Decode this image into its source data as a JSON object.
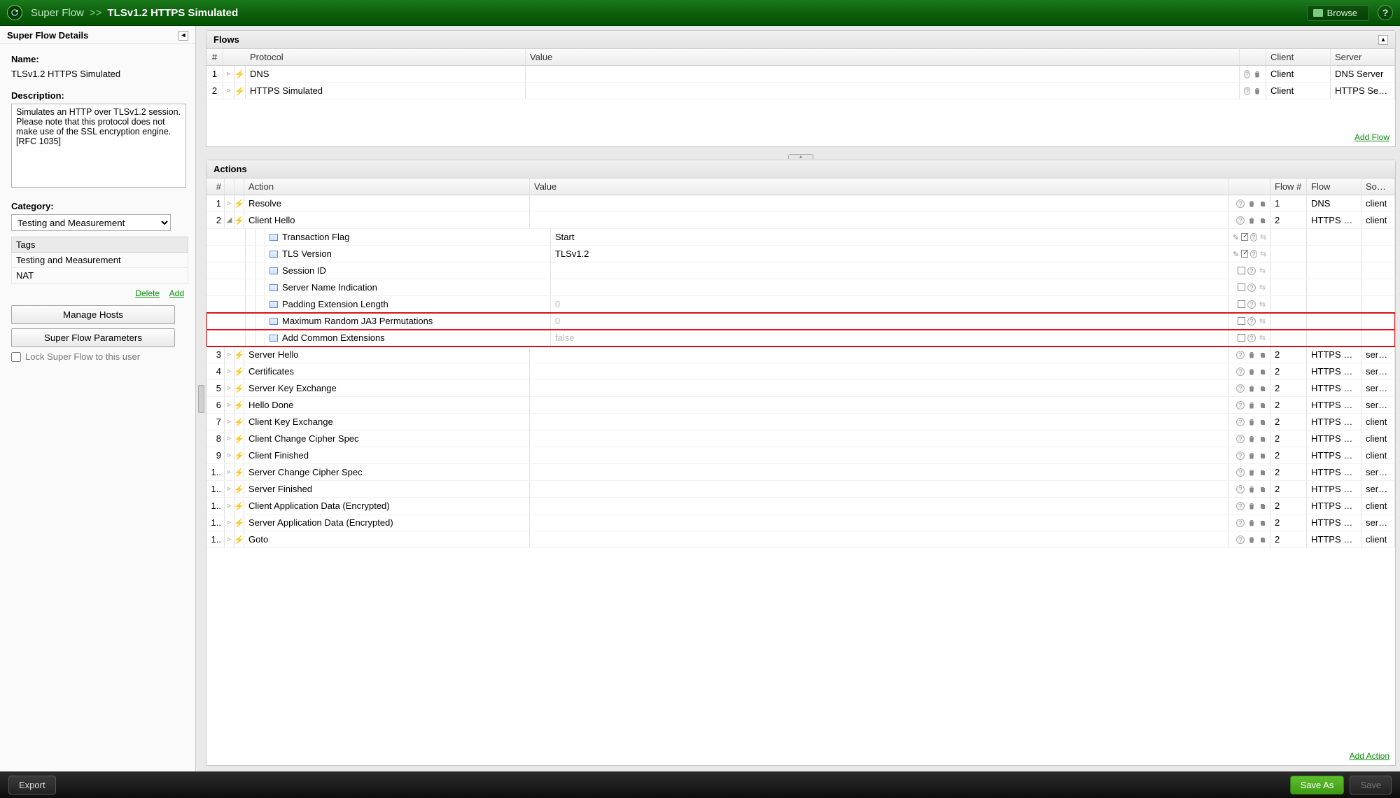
{
  "topbar": {
    "breadcrumb_root": "Super Flow",
    "breadcrumb_sep": ">>",
    "breadcrumb_current": "TLSv1.2 HTTPS Simulated",
    "browse": "Browse",
    "help": "?"
  },
  "side": {
    "panel_title": "Super Flow Details",
    "name_label": "Name:",
    "name_value": "TLSv1.2 HTTPS Simulated",
    "desc_label": "Description:",
    "desc_value": "Simulates an HTTP over TLSv1.2 session. Please note that this protocol does not make use of the SSL encryption engine.[RFC 1035]",
    "cat_label": "Category:",
    "cat_value": "Testing and Measurement",
    "tags_header": "Tags",
    "tags": [
      "Testing and Measurement",
      "NAT"
    ],
    "delete": "Delete",
    "add": "Add",
    "manage_hosts": "Manage Hosts",
    "sf_params": "Super Flow Parameters",
    "lock_label": "Lock Super Flow to this user"
  },
  "flows_panel": {
    "title": "Flows",
    "headers": {
      "num": "#",
      "protocol": "Protocol",
      "value": "Value",
      "client": "Client",
      "server": "Server"
    },
    "rows": [
      {
        "num": "1",
        "protocol": "DNS",
        "value": "",
        "client": "Client",
        "server": "DNS Server"
      },
      {
        "num": "2",
        "protocol": "HTTPS Simulated",
        "value": "",
        "client": "Client",
        "server": "HTTPS Server"
      }
    ],
    "add_flow": "Add Flow"
  },
  "actions_panel": {
    "title": "Actions",
    "headers": {
      "num": "#",
      "action": "Action",
      "value": "Value",
      "flownum": "Flow #",
      "flow": "Flow",
      "source": "Source"
    },
    "rows": [
      {
        "num": "1",
        "action": "Resolve",
        "value": "",
        "flownum": "1",
        "flow": "DNS",
        "source": "client",
        "exp": "▹"
      },
      {
        "num": "2",
        "action": "Client Hello",
        "value": "",
        "flownum": "2",
        "flow": "HTTPS Sim...",
        "source": "client",
        "exp": "◢",
        "children": [
          {
            "action": "Transaction Flag",
            "value": "Start",
            "ctrl": "edit"
          },
          {
            "action": "TLS Version",
            "value": "TLSv1.2",
            "ctrl": "edit"
          },
          {
            "action": "Session ID",
            "value": "",
            "ctrl": "cb"
          },
          {
            "action": "Server Name Indication",
            "value": "",
            "ctrl": "cb"
          },
          {
            "action": "Padding Extension Length",
            "value": "0",
            "ghost": true,
            "ctrl": "cb"
          },
          {
            "action": "Maximum Random JA3 Permutations",
            "value": "0",
            "ghost": true,
            "ctrl": "cb",
            "hl": true
          },
          {
            "action": "Add Common Extensions",
            "value": "false",
            "ghost": true,
            "ctrl": "cb",
            "hl": true
          }
        ]
      },
      {
        "num": "3",
        "action": "Server Hello",
        "value": "",
        "flownum": "2",
        "flow": "HTTPS Sim...",
        "source": "server",
        "exp": "▹"
      },
      {
        "num": "4",
        "action": "Certificates",
        "value": "",
        "flownum": "2",
        "flow": "HTTPS Sim...",
        "source": "server",
        "exp": "▹"
      },
      {
        "num": "5",
        "action": "Server Key Exchange",
        "value": "",
        "flownum": "2",
        "flow": "HTTPS Sim...",
        "source": "server",
        "exp": "▹"
      },
      {
        "num": "6",
        "action": "Hello Done",
        "value": "",
        "flownum": "2",
        "flow": "HTTPS Sim...",
        "source": "server",
        "exp": "▹"
      },
      {
        "num": "7",
        "action": "Client Key Exchange",
        "value": "",
        "flownum": "2",
        "flow": "HTTPS Sim...",
        "source": "client",
        "exp": "▹"
      },
      {
        "num": "8",
        "action": "Client Change Cipher Spec",
        "value": "",
        "flownum": "2",
        "flow": "HTTPS Sim...",
        "source": "client",
        "exp": "▹"
      },
      {
        "num": "9",
        "action": "Client Finished",
        "value": "",
        "flownum": "2",
        "flow": "HTTPS Sim...",
        "source": "client",
        "exp": "▹"
      },
      {
        "num": "1..",
        "action": "Server Change Cipher Spec",
        "value": "",
        "flownum": "2",
        "flow": "HTTPS Sim...",
        "source": "server",
        "exp": "▹"
      },
      {
        "num": "1..",
        "action": "Server Finished",
        "value": "",
        "flownum": "2",
        "flow": "HTTPS Sim...",
        "source": "server",
        "exp": "▹"
      },
      {
        "num": "1..",
        "action": "Client Application Data (Encrypted)",
        "value": "",
        "flownum": "2",
        "flow": "HTTPS Sim...",
        "source": "client",
        "exp": "▹"
      },
      {
        "num": "1..",
        "action": "Server Application Data (Encrypted)",
        "value": "",
        "flownum": "2",
        "flow": "HTTPS Sim...",
        "source": "server",
        "exp": "▹"
      },
      {
        "num": "1..",
        "action": "Goto",
        "value": "",
        "flownum": "2",
        "flow": "HTTPS Sim...",
        "source": "client",
        "exp": "▹"
      }
    ],
    "add_action": "Add Action"
  },
  "bottom": {
    "export": "Export",
    "save_as": "Save As",
    "save": "Save"
  }
}
